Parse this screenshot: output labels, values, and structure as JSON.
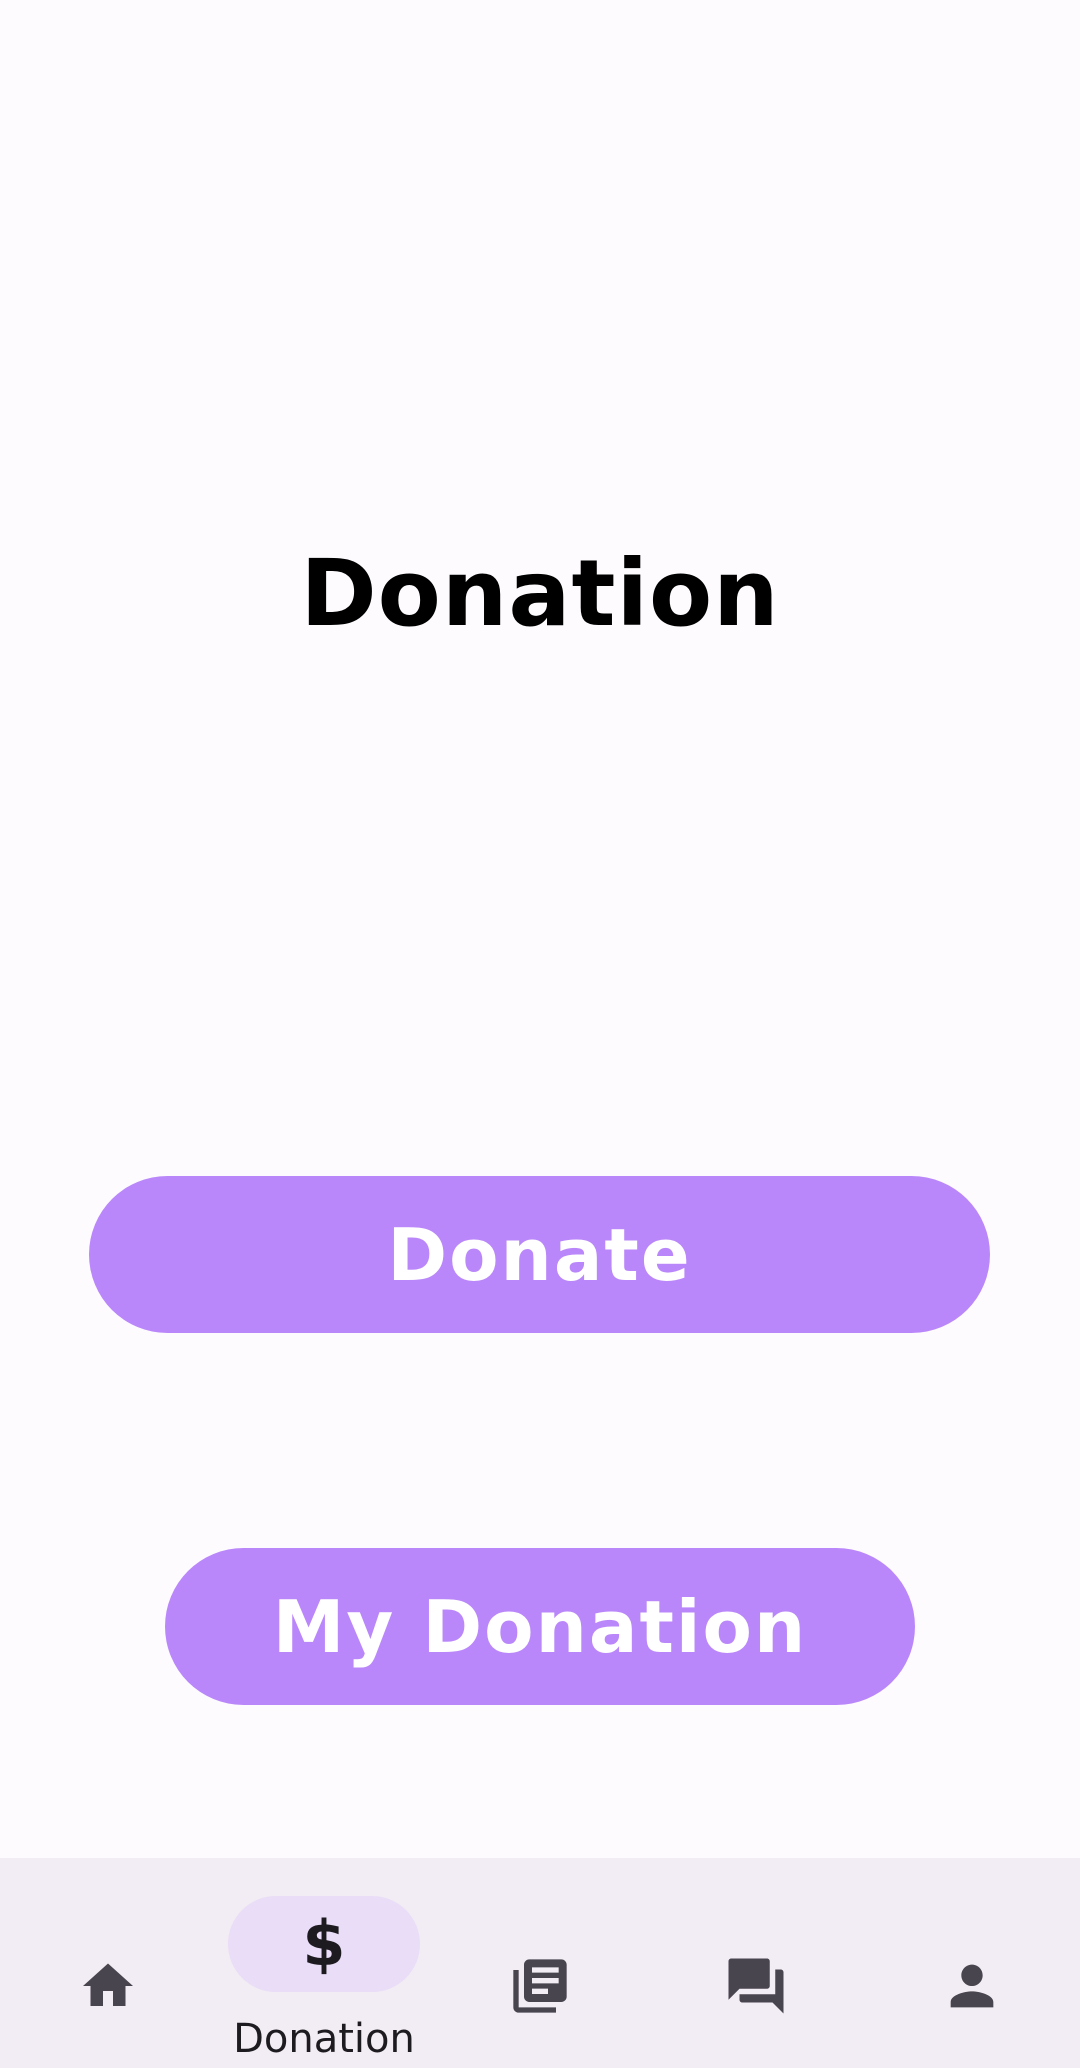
{
  "main": {
    "title": "Donation",
    "donate_button": "Donate",
    "my_donation_button": "My Donation"
  },
  "bottom_nav": {
    "items": [
      {
        "icon": "home-icon",
        "label": "",
        "active": false
      },
      {
        "icon": "dollar-icon",
        "icon_glyph": "$",
        "label": "Donation",
        "active": true
      },
      {
        "icon": "article-icon",
        "label": "",
        "active": false
      },
      {
        "icon": "forum-icon",
        "label": "",
        "active": false
      },
      {
        "icon": "person-icon",
        "label": "",
        "active": false
      }
    ]
  },
  "colors": {
    "background": "#fdfbfe",
    "button": "#ba87fa",
    "button_text": "#ffffff",
    "nav_background": "#f2ecf4",
    "active_indicator": "#e9ddf7",
    "icon": "#49454f"
  }
}
